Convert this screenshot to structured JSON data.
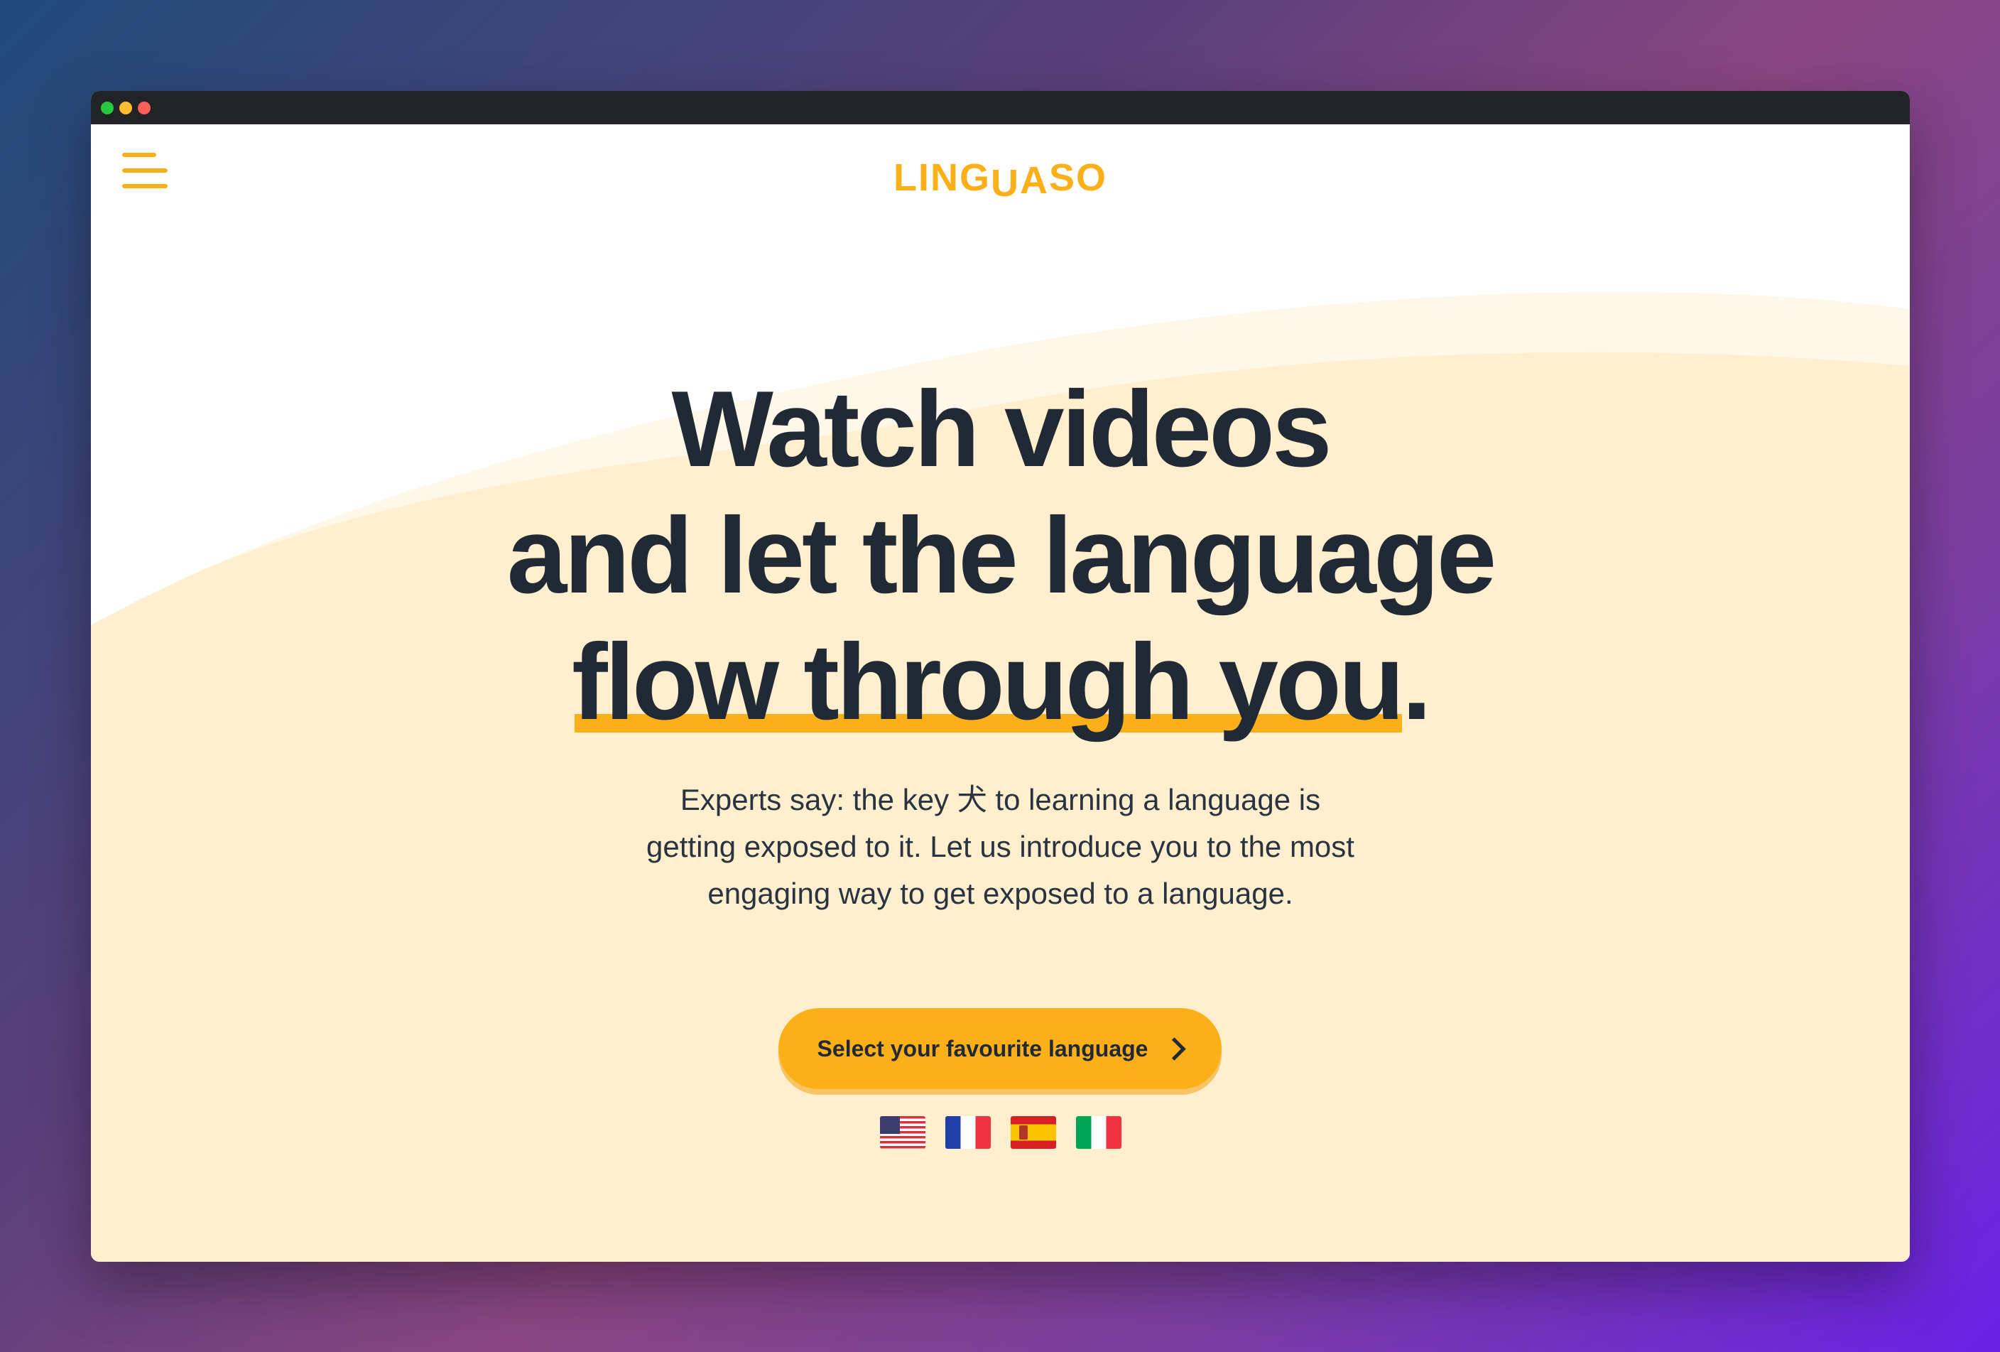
{
  "window": {
    "controls": [
      "close",
      "minimize",
      "maximize"
    ]
  },
  "header": {
    "menu_icon": "hamburger-menu-icon",
    "logo_parts": [
      "LING",
      "U",
      "A",
      "SO"
    ]
  },
  "hero": {
    "headline_line1": "Watch videos",
    "headline_line2": "and let the language",
    "headline_line3_highlight": "flow through you",
    "headline_line3_punct": ".",
    "subtext_line1": "Experts say: the key ⽝ to learning a language is",
    "subtext_line2": "getting exposed to it. Let us introduce you to the most",
    "subtext_line3": "engaging way to get exposed to a language.",
    "cta_label": "Select your favourite language",
    "cta_icon": "chevron-right-icon",
    "mascot_icon": "peeking-eye-mascot-icon"
  },
  "languages": [
    {
      "icon": "us-flag-icon"
    },
    {
      "icon": "france-flag-icon"
    },
    {
      "icon": "spain-flag-icon"
    },
    {
      "icon": "italy-flag-icon"
    }
  ],
  "colors": {
    "accent": "#fbb01a",
    "text": "#212a34",
    "background": "#ffefcf",
    "titlebar": "#212327"
  }
}
